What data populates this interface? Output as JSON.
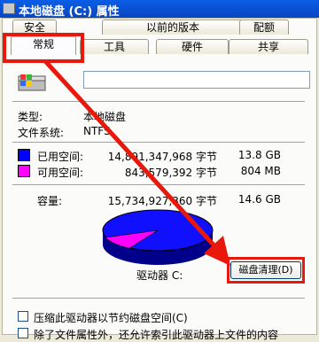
{
  "window": {
    "title": "本地磁盘 (C:) 属性"
  },
  "tabs_back": [
    "安全",
    "以前的版本",
    "配额"
  ],
  "tabs_front": [
    "常规",
    "工具",
    "硬件",
    "共享"
  ],
  "general": {
    "name_value": "",
    "type_label": "类型:",
    "type_value": "本地磁盘",
    "fs_label": "文件系统:",
    "fs_value": "NTFS",
    "used": {
      "label": "已用空间:",
      "bytes": "14,891,347,968 字节",
      "size": "13.8 GB",
      "color": "#0000ff"
    },
    "free": {
      "label": "可用空间:",
      "bytes": "843,579,392 字节",
      "size": "804 MB",
      "color": "#ff00ff"
    },
    "capacity": {
      "label": "容量:",
      "bytes": "15,734,927,360 字节",
      "size": "14.6 GB"
    },
    "drive_label": "驱动器 C:",
    "cleanup_button": "磁盘清理(D)",
    "compress_label": "压缩此驱动器以节约磁盘空间(C)",
    "index_label": "除了文件属性外，还允许索引此驱动器上文件的内容"
  },
  "annotation": {
    "color": "#e8190c"
  }
}
